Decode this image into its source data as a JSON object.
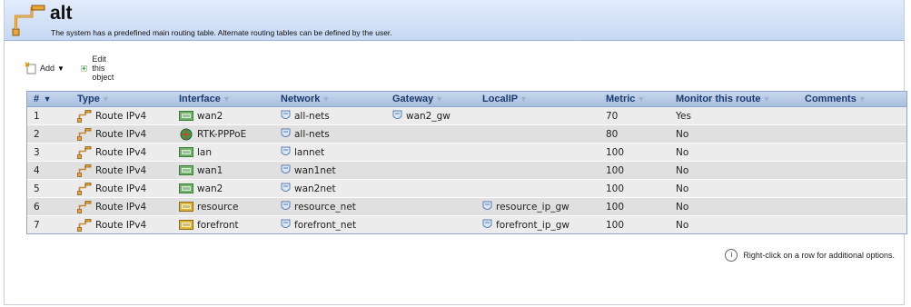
{
  "header": {
    "title": "alt",
    "subtitle": "The system has a predefined main routing table. Alternate routing tables can be defined by the user.",
    "icon": "route-icon"
  },
  "toolbar": {
    "add_label": "Add",
    "edit_label": "Edit this object"
  },
  "table": {
    "columns": [
      "#",
      "Type",
      "Interface",
      "Network",
      "Gateway",
      "LocalIP",
      "Metric",
      "Monitor this route",
      "Comments"
    ],
    "rows": [
      {
        "num": "1",
        "type": "Route IPv4",
        "interface": "wan2",
        "interface_icon": "ethernet-icon",
        "network": "all-nets",
        "gateway": "wan2_gw",
        "localip": "",
        "metric": "70",
        "monitor": "Yes",
        "comments": ""
      },
      {
        "num": "2",
        "type": "Route IPv4",
        "interface": "RTK-PPPoE",
        "interface_icon": "pppoe-icon",
        "network": "all-nets",
        "gateway": "",
        "localip": "",
        "metric": "80",
        "monitor": "No",
        "comments": ""
      },
      {
        "num": "3",
        "type": "Route IPv4",
        "interface": "lan",
        "interface_icon": "ethernet-icon",
        "network": "lannet",
        "gateway": "",
        "localip": "",
        "metric": "100",
        "monitor": "No",
        "comments": ""
      },
      {
        "num": "4",
        "type": "Route IPv4",
        "interface": "wan1",
        "interface_icon": "ethernet-icon",
        "network": "wan1net",
        "gateway": "",
        "localip": "",
        "metric": "100",
        "monitor": "No",
        "comments": ""
      },
      {
        "num": "5",
        "type": "Route IPv4",
        "interface": "wan2",
        "interface_icon": "ethernet-icon",
        "network": "wan2net",
        "gateway": "",
        "localip": "",
        "metric": "100",
        "monitor": "No",
        "comments": ""
      },
      {
        "num": "6",
        "type": "Route IPv4",
        "interface": "resource",
        "interface_icon": "vlan-icon",
        "network": "resource_net",
        "gateway": "",
        "localip": "resource_ip_gw",
        "metric": "100",
        "monitor": "No",
        "comments": ""
      },
      {
        "num": "7",
        "type": "Route IPv4",
        "interface": "forefront",
        "interface_icon": "vlan-icon",
        "network": "forefront_net",
        "gateway": "",
        "localip": "forefront_ip_gw",
        "metric": "100",
        "monitor": "No",
        "comments": ""
      }
    ]
  },
  "hint": "Right-click on a row for additional options."
}
